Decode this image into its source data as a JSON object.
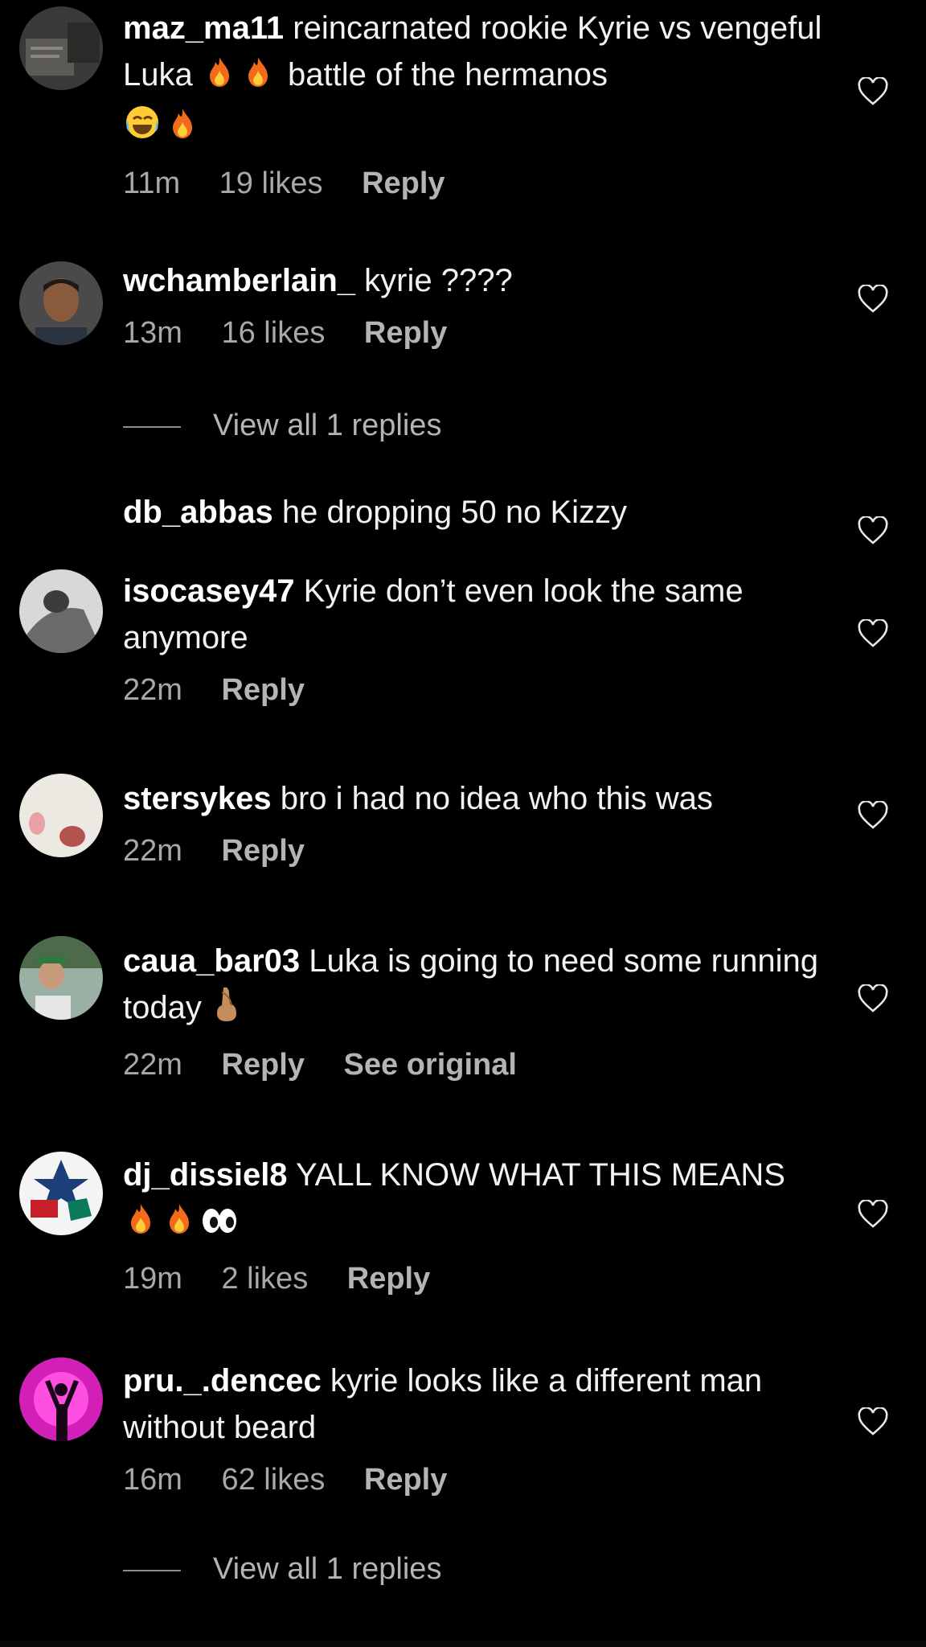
{
  "comments": [
    {
      "user": "maz_ma11",
      "text": "reincarnated rookie Kyrie vs vengeful Luka",
      "text_after_emoji": "battle of the hermanos",
      "time": "11m",
      "likes": "19 likes",
      "reply": "Reply",
      "emoji_1": "fire",
      "emoji_2": "laughing-tears"
    },
    {
      "user": "wchamberlain_",
      "text": "kyrie ????",
      "time": "13m",
      "likes": "16 likes",
      "reply": "Reply"
    },
    {
      "user": "db_abbas",
      "text": "he dropping 50 no Kizzy"
    },
    {
      "user": "isocasey47",
      "text": "Kyrie don’t even look the same anymore",
      "time": "22m",
      "reply": "Reply"
    },
    {
      "user": "stersykes",
      "text": "bro i had no idea who this was",
      "time": "22m",
      "reply": "Reply"
    },
    {
      "user": "caua_bar03",
      "text": "Luka is going to need some running today",
      "time": "22m",
      "reply": "Reply",
      "see_original": "See original"
    },
    {
      "user": "dj_dissiel8",
      "text": "YALL KNOW WHAT THIS MEANS",
      "time": "19m",
      "likes": "2 likes",
      "reply": "Reply"
    },
    {
      "user": "pru._.dencec",
      "text": "kyrie looks like a different man without beard",
      "time": "16m",
      "likes": "62 likes",
      "reply": "Reply"
    }
  ],
  "view_replies_1": "View all 1 replies",
  "view_replies_2": "View all 1 replies",
  "icons": {
    "like": "heart-outline-icon",
    "fire": "fire-emoji",
    "eyes": "eyes-emoji",
    "laugh": "laughing-tears-emoji",
    "hand": "crossed-fingers-emoji"
  },
  "colors": {
    "background": "#000000",
    "text": "#f5f5f5",
    "meta": "#a8a8a8"
  }
}
